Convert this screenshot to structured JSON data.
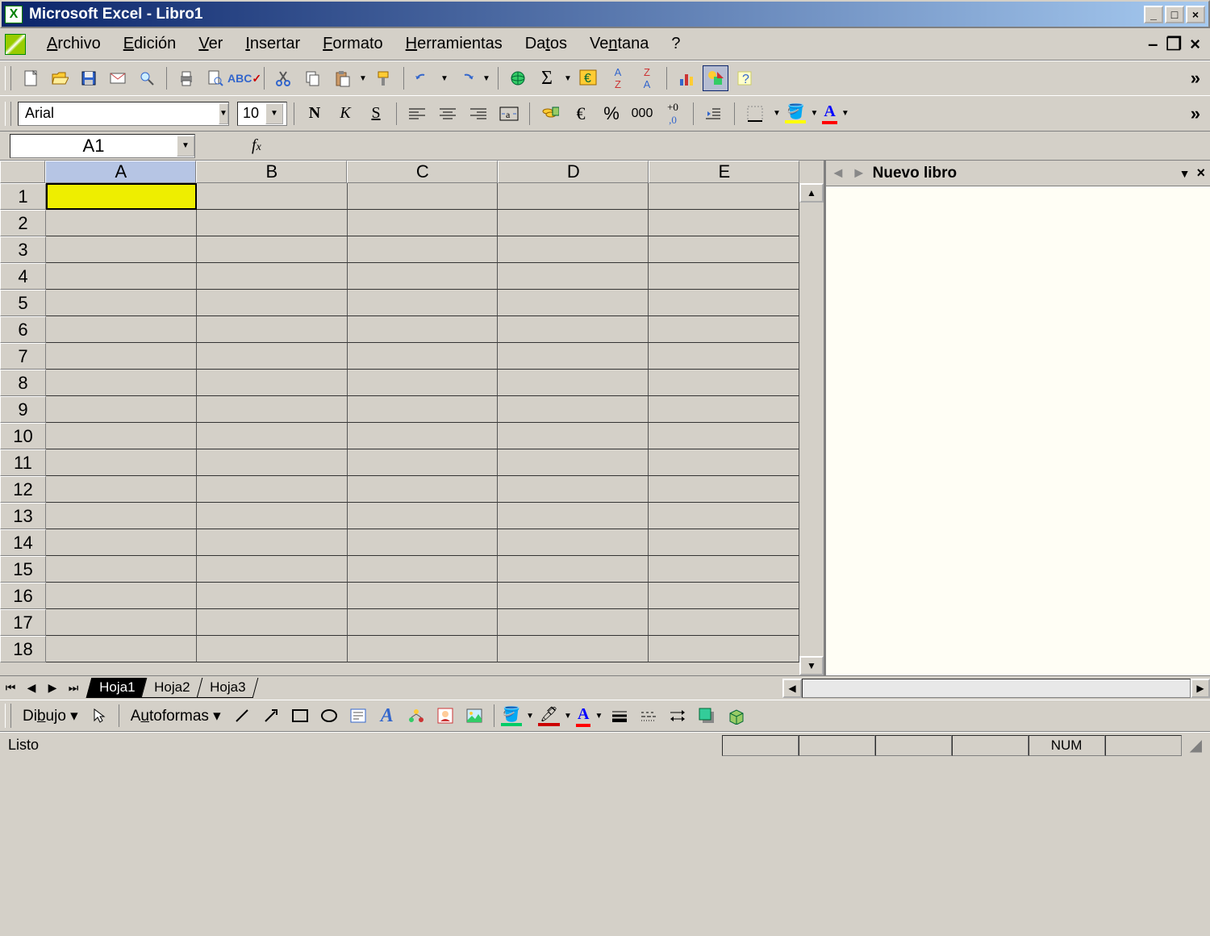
{
  "titlebar": {
    "app": "Microsoft Excel",
    "doc": "Libro1"
  },
  "menu": {
    "archivo": "Archivo",
    "edicion": "Edición",
    "ver": "Ver",
    "insertar": "Insertar",
    "formato": "Formato",
    "herramientas": "Herramientas",
    "datos": "Datos",
    "ventana": "Ventana",
    "ayuda": "?"
  },
  "format": {
    "font": "Arial",
    "size": "10"
  },
  "namebox": {
    "ref": "A1"
  },
  "fx": {
    "label": "f",
    "sub": "x"
  },
  "cols": [
    "A",
    "B",
    "C",
    "D",
    "E"
  ],
  "rows": [
    "1",
    "2",
    "3",
    "4",
    "5",
    "6",
    "7",
    "8",
    "9",
    "10",
    "11",
    "12",
    "13",
    "14",
    "15",
    "16",
    "17",
    "18"
  ],
  "active_cell": {
    "row": 0,
    "col": 0
  },
  "sheets": [
    "Hoja1",
    "Hoja2",
    "Hoja3"
  ],
  "active_sheet": 0,
  "taskpane": {
    "title": "Nuevo libro"
  },
  "draw": {
    "dibujo": "Dibujo",
    "autoformas": "Autoformas"
  },
  "status": {
    "ready": "Listo",
    "num": "NUM"
  }
}
